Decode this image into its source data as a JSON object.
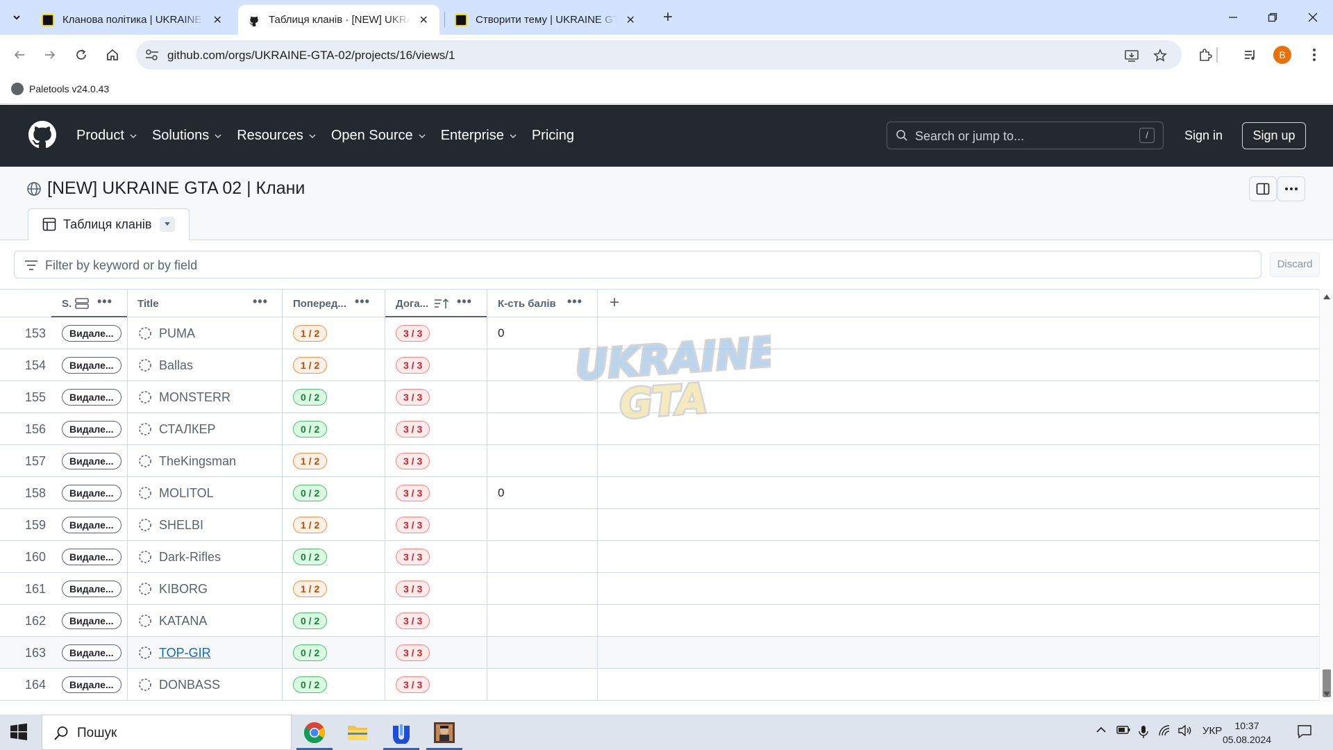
{
  "browser": {
    "tabs": [
      {
        "title": "Кланова політика | UKRAINE G",
        "active": false
      },
      {
        "title": "Таблиця кланів · [NEW] UKRAII",
        "active": true
      },
      {
        "title": "Створити тему | UKRAINE GTA",
        "active": false
      }
    ],
    "url": "github.com/orgs/UKRAINE-GTA-02/projects/16/views/1",
    "profile_initial": "B",
    "bookmark": "Paletools v24.0.43"
  },
  "github": {
    "nav": [
      "Product",
      "Solutions",
      "Resources",
      "Open Source",
      "Enterprise",
      "Pricing"
    ],
    "search_placeholder": "Search or jump to...",
    "search_shortcut": "/",
    "sign_in": "Sign in",
    "sign_up": "Sign up"
  },
  "project": {
    "title": "[NEW] UKRAINE GTA 02 | Клани",
    "view_tab": "Таблиця кланів",
    "filter_placeholder": "Filter by keyword or by field",
    "discard": "Discard"
  },
  "table": {
    "columns": {
      "status": "S.",
      "title": "Title",
      "warnings": "Поперед...",
      "contracts": "Дога...",
      "points": "К-сть балів"
    },
    "rows": [
      {
        "num": "153",
        "status": "Видале...",
        "title": "PUMA",
        "warn": "1 / 2",
        "warn_color": "orange",
        "contract": "3 / 3",
        "points": "0"
      },
      {
        "num": "154",
        "status": "Видале...",
        "title": "Ballas",
        "warn": "1 / 2",
        "warn_color": "orange",
        "contract": "3 / 3",
        "points": ""
      },
      {
        "num": "155",
        "status": "Видале...",
        "title": "MONSTERR",
        "warn": "0 / 2",
        "warn_color": "green",
        "contract": "3 / 3",
        "points": ""
      },
      {
        "num": "156",
        "status": "Видале...",
        "title": "СТАЛКЕР",
        "warn": "0 / 2",
        "warn_color": "green",
        "contract": "3 / 3",
        "points": ""
      },
      {
        "num": "157",
        "status": "Видале...",
        "title": "TheKingsman",
        "warn": "1 / 2",
        "warn_color": "orange",
        "contract": "3 / 3",
        "points": ""
      },
      {
        "num": "158",
        "status": "Видале...",
        "title": "MOLITOL",
        "warn": "0 / 2",
        "warn_color": "green",
        "contract": "3 / 3",
        "points": "0"
      },
      {
        "num": "159",
        "status": "Видале...",
        "title": "SHELBI",
        "warn": "1 / 2",
        "warn_color": "orange",
        "contract": "3 / 3",
        "points": ""
      },
      {
        "num": "160",
        "status": "Видале...",
        "title": "Dark-Rifles",
        "warn": "0 / 2",
        "warn_color": "green",
        "contract": "3 / 3",
        "points": ""
      },
      {
        "num": "161",
        "status": "Видале...",
        "title": "KIBORG",
        "warn": "1 / 2",
        "warn_color": "orange",
        "contract": "3 / 3",
        "points": ""
      },
      {
        "num": "162",
        "status": "Видале...",
        "title": "KATANA",
        "warn": "0 / 2",
        "warn_color": "green",
        "contract": "3 / 3",
        "points": ""
      },
      {
        "num": "163",
        "status": "Видале...",
        "title": "TOP-GIR",
        "warn": "0 / 2",
        "warn_color": "green",
        "contract": "3 / 3",
        "points": "",
        "hover": true
      },
      {
        "num": "164",
        "status": "Видале...",
        "title": "DONBASS",
        "warn": "0 / 2",
        "warn_color": "green",
        "contract": "3 / 3",
        "points": ""
      }
    ]
  },
  "watermark": {
    "line1": "UKRAINE",
    "line2": "GTA"
  },
  "taskbar": {
    "search_placeholder": "Пошук",
    "language": "УКР",
    "time": "10:37",
    "date": "05.08.2024"
  },
  "colors": {
    "header_bg": "#24292f",
    "tabstrip_bg": "#d3e3fd",
    "warn_orange": "#bc4c00",
    "ok_green": "#1a7f37",
    "danger_red": "#cf222e",
    "link": "#0969da"
  }
}
